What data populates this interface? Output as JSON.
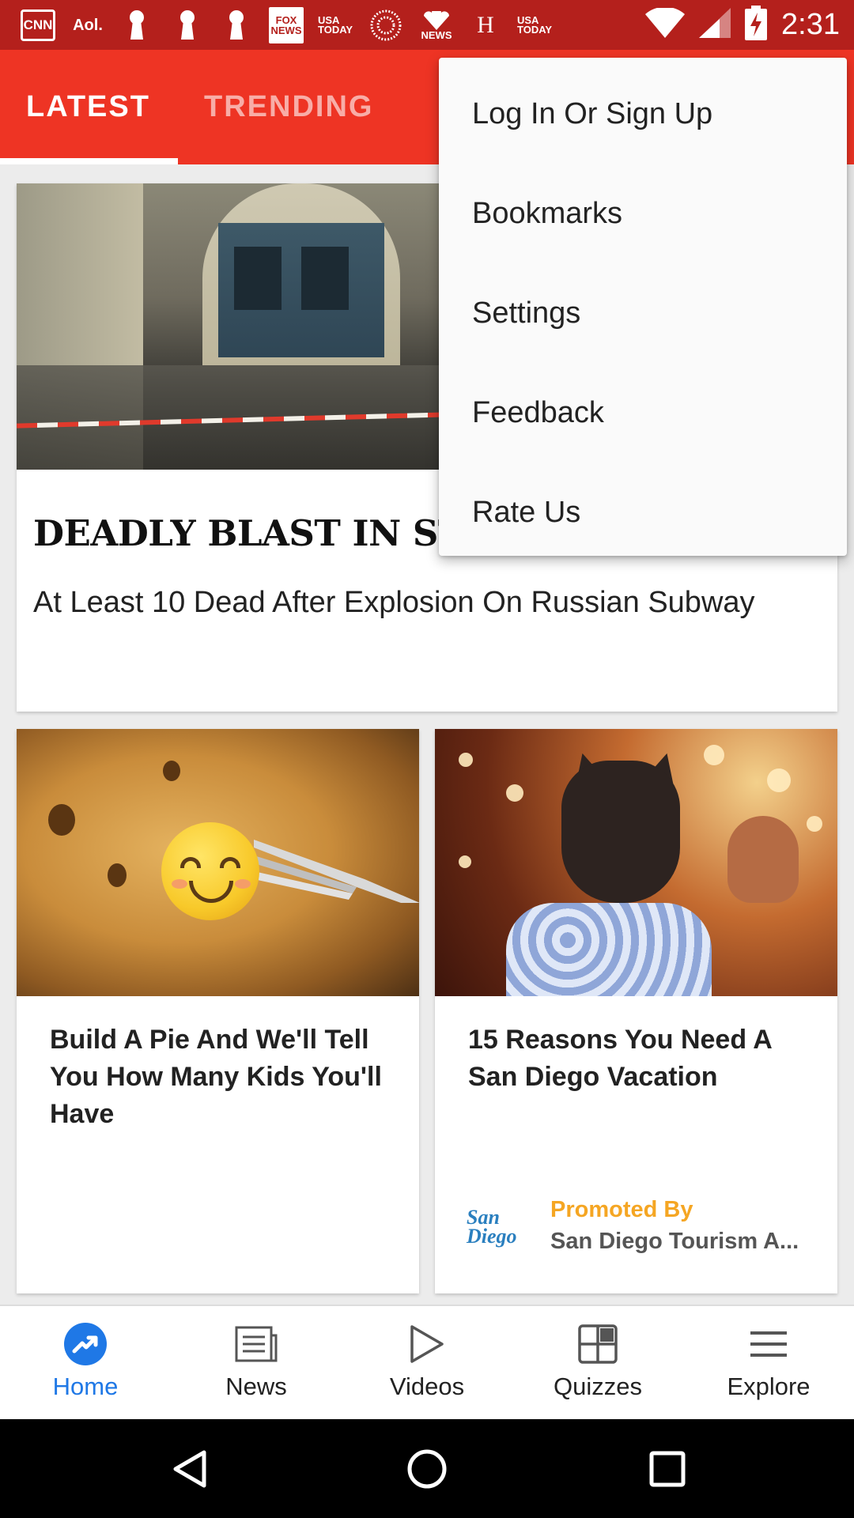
{
  "status_bar": {
    "time": "2:31",
    "notification_icons": [
      "cnn-icon",
      "aol-icon",
      "keyhole-icon",
      "keyhole-icon",
      "keyhole-icon",
      "fox-news-icon",
      "usa-today-icon",
      "ring-icon",
      "nbc-news-icon",
      "huffpost-icon",
      "usa-today-icon"
    ],
    "cnn_label": "CNN",
    "aol_label": "Aol.",
    "fox_label_top": "FOX",
    "fox_label_bottom": "NEWS",
    "usa_top": "USA",
    "usa_bottom": "TODAY",
    "nbc_label": "NEWS",
    "h_label": "H"
  },
  "tabs": {
    "latest": "LATEST",
    "trending": "TRENDING"
  },
  "overflow_menu": {
    "items": [
      "Log In Or Sign Up",
      "Bookmarks",
      "Settings",
      "Feedback",
      "Rate Us"
    ]
  },
  "feed": {
    "main_card": {
      "title": "DEADLY BLAST IN ST",
      "subtitle": "At Least 10 Dead After Explosion On Russian Subway"
    },
    "card_pie": {
      "title": "Build A Pie And We'll Tell You How Many Kids You'll Have"
    },
    "card_sd": {
      "title": "15 Reasons You Need A San Diego Vacation",
      "promo_label": "Promoted By",
      "promo_name": "San Diego Tourism A...",
      "promo_logo_text": "San Diego"
    }
  },
  "bottom_nav": {
    "items": [
      {
        "label": "Home",
        "icon": "trending-icon"
      },
      {
        "label": "News",
        "icon": "newspaper-icon"
      },
      {
        "label": "Videos",
        "icon": "play-icon"
      },
      {
        "label": "Quizzes",
        "icon": "grid-icon"
      },
      {
        "label": "Explore",
        "icon": "menu-icon"
      }
    ],
    "active_color": "#1f78e6"
  },
  "colors": {
    "status_bar": "#b4201c",
    "header": "#ee3424",
    "promo": "#f5a623"
  }
}
